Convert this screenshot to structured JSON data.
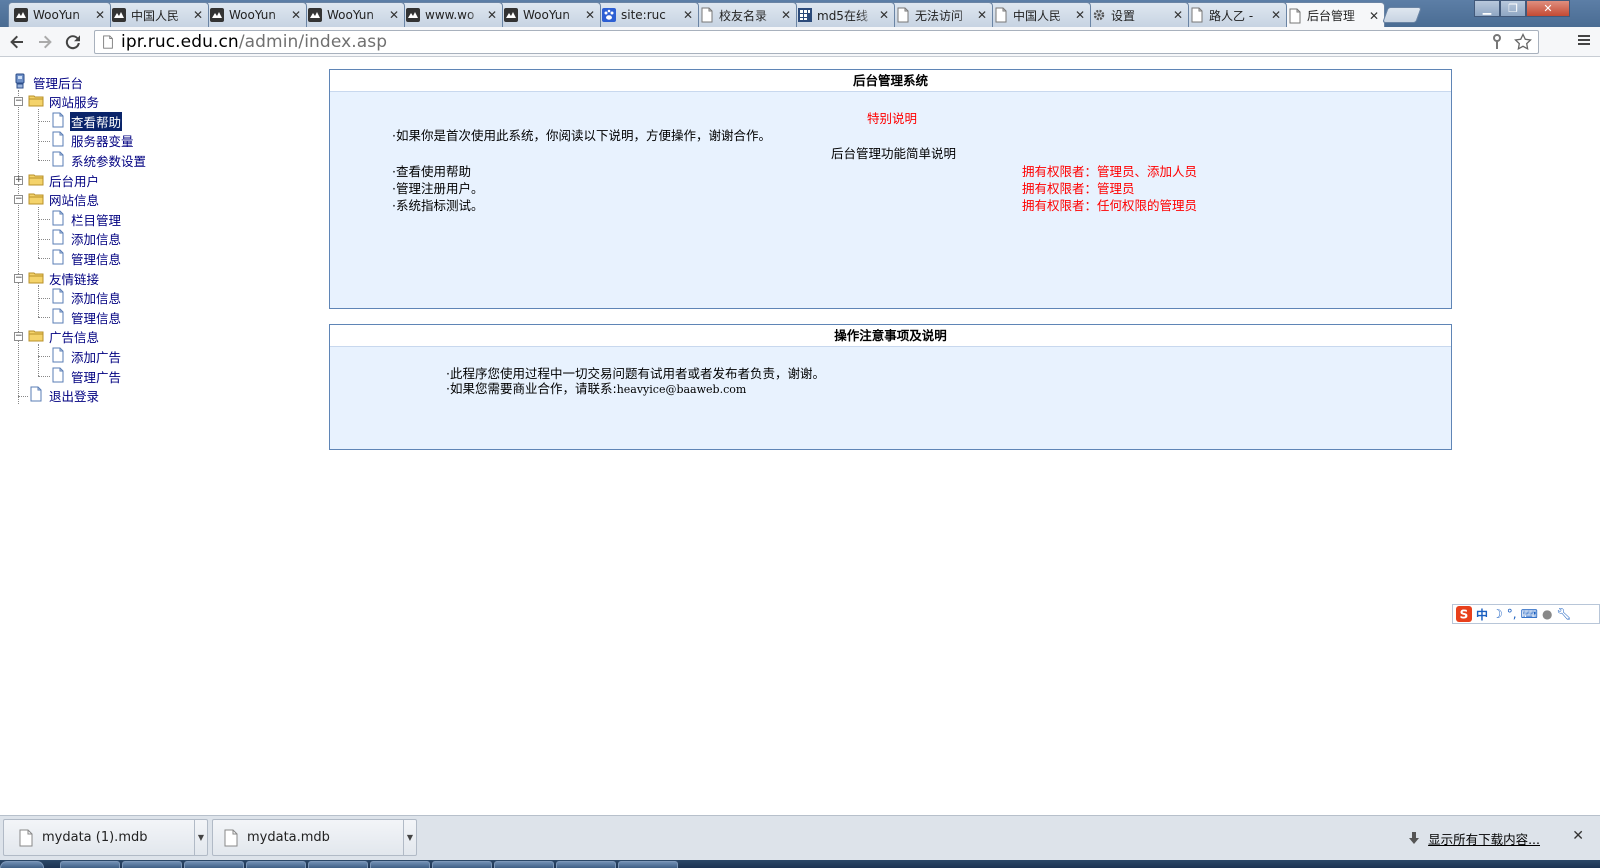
{
  "browser": {
    "tabs": [
      {
        "label": "WooYun",
        "icon": "cloud-icon"
      },
      {
        "label": "中国人民",
        "icon": "cloud-icon"
      },
      {
        "label": "WooYun",
        "icon": "cloud-icon"
      },
      {
        "label": "WooYun",
        "icon": "cloud-icon"
      },
      {
        "label": "www.wo",
        "icon": "cloud-icon"
      },
      {
        "label": "WooYun",
        "icon": "cloud-icon"
      },
      {
        "label": "site:ruc",
        "icon": "baidu-paw-icon"
      },
      {
        "label": "校友名录",
        "icon": "page-icon"
      },
      {
        "label": "md5在线",
        "icon": "grid-icon"
      },
      {
        "label": "无法访问",
        "icon": "page-icon"
      },
      {
        "label": "中国人民",
        "icon": "page-icon"
      },
      {
        "label": "设置",
        "icon": "gear-icon"
      },
      {
        "label": "路人乙 -",
        "icon": "page-icon"
      },
      {
        "label": "后台管理",
        "icon": "page-icon",
        "active": true
      }
    ],
    "url_host": "ipr.ruc.edu.cn",
    "url_path": "/admin/index.asp"
  },
  "tree": {
    "root": "管理后台",
    "items": [
      {
        "label": "网站服务"
      },
      {
        "label": "查看帮助",
        "selected": true
      },
      {
        "label": "服务器变量"
      },
      {
        "label": "系统参数设置"
      },
      {
        "label": "后台用户"
      },
      {
        "label": "网站信息"
      },
      {
        "label": "栏目管理"
      },
      {
        "label": "添加信息"
      },
      {
        "label": "管理信息"
      },
      {
        "label": "友情链接"
      },
      {
        "label": "添加信息"
      },
      {
        "label": "管理信息"
      },
      {
        "label": "广告信息"
      },
      {
        "label": "添加广告"
      },
      {
        "label": "管理广告"
      },
      {
        "label": "退出登录"
      }
    ]
  },
  "panel1": {
    "title": "后台管理系统",
    "special": "特别说明",
    "intro": "·如果你是首次使用此系统，你阅读以下说明，方便操作，谢谢合作。",
    "subtitle": "后台管理功能简单说明",
    "rows": [
      {
        "left": "·查看使用帮助",
        "right": "拥有权限者：管理员、添加人员"
      },
      {
        "left": "·管理注册用户。",
        "right": "拥有权限者：管理员"
      },
      {
        "left": "·系统指标测试。",
        "right": "拥有权限者：任何权限的管理员"
      }
    ]
  },
  "panel2": {
    "title": "操作注意事项及说明",
    "line1": "·此程序您使用过程中一切交易问题有试用者或者发布者负责，谢谢。",
    "line2_prefix": "·如果您需要商业合作，请联系:",
    "line2_email": "heavyice@baaweb.com"
  },
  "ime": {
    "label": "中"
  },
  "downloads": {
    "items": [
      "mydata (1).mdb",
      "mydata.mdb"
    ],
    "show_all": "显示所有下载内容..."
  },
  "colors": {
    "link": "#000080",
    "accent_red": "#ff0000",
    "panel_bg": "#e8f2fe",
    "panel_border": "#5f85b6"
  }
}
